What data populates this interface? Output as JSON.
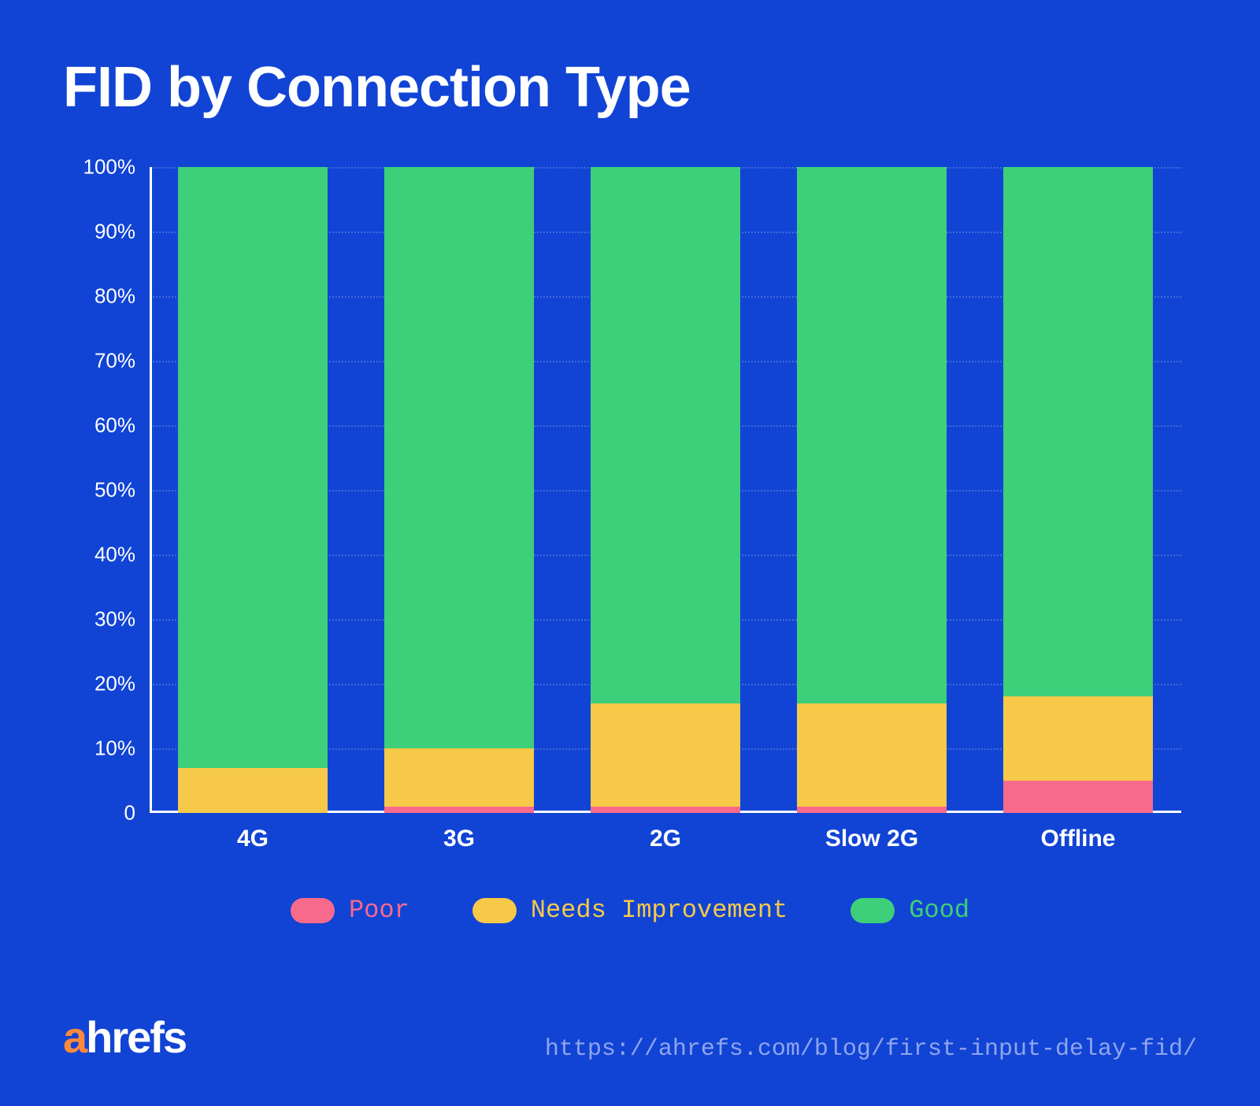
{
  "title": "FID by Connection Type",
  "chart_data": {
    "type": "bar",
    "stacked": true,
    "categories": [
      "4G",
      "3G",
      "2G",
      "Slow 2G",
      "Offline"
    ],
    "series": [
      {
        "name": "Poor",
        "color": "#f76a8c",
        "values": [
          0,
          1,
          1,
          1,
          5
        ]
      },
      {
        "name": "Needs Improvement",
        "color": "#f7c948",
        "values": [
          7,
          9,
          16,
          16,
          13
        ]
      },
      {
        "name": "Good",
        "color": "#3ecf7a",
        "values": [
          93,
          90,
          83,
          83,
          82
        ]
      }
    ],
    "ylabel": "",
    "xlabel": "",
    "ylim": [
      0,
      100
    ],
    "yticks": [
      "0",
      "10%",
      "20%",
      "30%",
      "40%",
      "50%",
      "60%",
      "70%",
      "80%",
      "90%",
      "100%"
    ]
  },
  "legend": {
    "poor": "Poor",
    "needs": "Needs Improvement",
    "good": "Good"
  },
  "footer": {
    "brand_a": "a",
    "brand_rest": "hrefs",
    "url": "https://ahrefs.com/blog/first-input-delay-fid/"
  }
}
